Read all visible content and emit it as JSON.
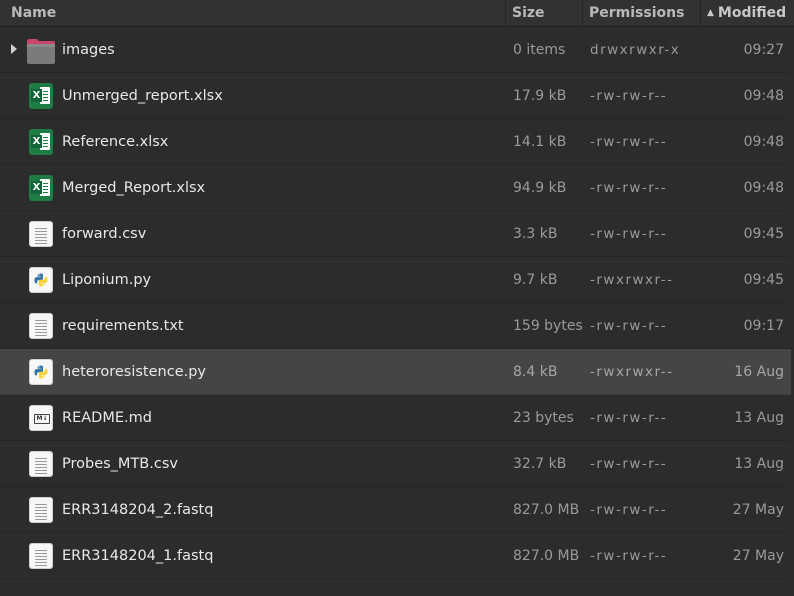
{
  "columns": {
    "name": "Name",
    "size": "Size",
    "permissions": "Permissions",
    "modified": "Modified",
    "sort_indicator": "▲"
  },
  "files": [
    {
      "name": "images",
      "size": "0 items",
      "permissions": "drwxrwxr-x",
      "modified": "09:27",
      "icon": "folder-icon",
      "type": "folder"
    },
    {
      "name": "Unmerged_report.xlsx",
      "size": "17.9 kB",
      "permissions": "-rw-rw-r--",
      "modified": "09:48",
      "icon": "spreadsheet-icon",
      "type": "xlsx"
    },
    {
      "name": "Reference.xlsx",
      "size": "14.1 kB",
      "permissions": "-rw-rw-r--",
      "modified": "09:48",
      "icon": "spreadsheet-icon",
      "type": "xlsx"
    },
    {
      "name": "Merged_Report.xlsx",
      "size": "94.9 kB",
      "permissions": "-rw-rw-r--",
      "modified": "09:48",
      "icon": "spreadsheet-icon",
      "type": "xlsx"
    },
    {
      "name": "forward.csv",
      "size": "3.3 kB",
      "permissions": "-rw-rw-r--",
      "modified": "09:45",
      "icon": "text-file-icon",
      "type": "text"
    },
    {
      "name": "Liponium.py",
      "size": "9.7 kB",
      "permissions": "-rwxrwxr--",
      "modified": "09:45",
      "icon": "python-file-icon",
      "type": "py"
    },
    {
      "name": "requirements.txt",
      "size": "159 bytes",
      "permissions": "-rw-rw-r--",
      "modified": "09:17",
      "icon": "text-file-icon",
      "type": "text"
    },
    {
      "name": "heteroresistence.py",
      "size": "8.4 kB",
      "permissions": "-rwxrwxr--",
      "modified": "16 Aug",
      "icon": "python-file-icon",
      "type": "py",
      "selected": true
    },
    {
      "name": "README.md",
      "size": "23 bytes",
      "permissions": "-rw-rw-r--",
      "modified": "13 Aug",
      "icon": "markdown-file-icon",
      "type": "md"
    },
    {
      "name": "Probes_MTB.csv",
      "size": "32.7 kB",
      "permissions": "-rw-rw-r--",
      "modified": "13 Aug",
      "icon": "text-file-icon",
      "type": "text"
    },
    {
      "name": "ERR3148204_2.fastq",
      "size": "827.0 MB",
      "permissions": "-rw-rw-r--",
      "modified": "27 May",
      "icon": "text-file-icon",
      "type": "text"
    },
    {
      "name": "ERR3148204_1.fastq",
      "size": "827.0 MB",
      "permissions": "-rw-rw-r--",
      "modified": "27 May",
      "icon": "text-file-icon",
      "type": "text"
    }
  ],
  "colors": {
    "background": "#2c2c2c",
    "selected_row": "#454545",
    "header": "#323232",
    "spreadsheet_green": "#1e7d45",
    "folder_pink": "#c9456b",
    "python_blue": "#3572a5",
    "python_yellow": "#f7d33a"
  }
}
